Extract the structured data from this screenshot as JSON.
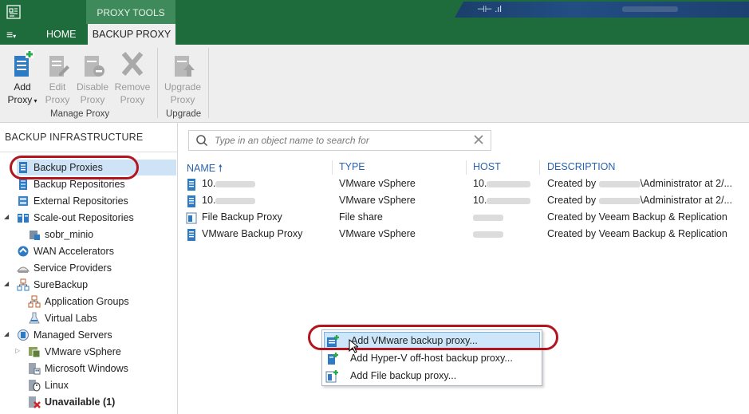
{
  "window": {
    "context_tab": "PROXY TOOLS"
  },
  "tabs": {
    "menu": "≡",
    "home": "HOME",
    "backup_proxy": "BACKUP PROXY"
  },
  "ribbon": {
    "buttons": [
      {
        "line1": "Add",
        "line2": "Proxy",
        "enabled": true,
        "icon": "add-proxy-icon"
      },
      {
        "line1": "Edit",
        "line2": "Proxy",
        "enabled": false,
        "icon": "edit-proxy-icon"
      },
      {
        "line1": "Disable",
        "line2": "Proxy",
        "enabled": false,
        "icon": "disable-proxy-icon"
      },
      {
        "line1": "Remove",
        "line2": "Proxy",
        "enabled": false,
        "icon": "remove-proxy-icon"
      },
      {
        "line1": "Upgrade",
        "line2": "Proxy",
        "enabled": false,
        "icon": "upgrade-proxy-icon"
      }
    ],
    "groups": {
      "manage": "Manage Proxy",
      "upgrade": "Upgrade"
    }
  },
  "nav": {
    "title": "BACKUP INFRASTRUCTURE",
    "items": [
      {
        "label": "Backup Proxies",
        "icon": "proxy-icon"
      },
      {
        "label": "Backup Repositories",
        "icon": "repository-icon"
      },
      {
        "label": "External Repositories",
        "icon": "external-repository-icon"
      },
      {
        "label": "Scale-out Repositories",
        "icon": "scaleout-repository-icon"
      },
      {
        "label": "sobr_minio",
        "icon": "sobr-icon"
      },
      {
        "label": "WAN Accelerators",
        "icon": "wan-accelerator-icon"
      },
      {
        "label": "Service Providers",
        "icon": "service-provider-icon"
      },
      {
        "label": "SureBackup",
        "icon": "surebackup-icon"
      },
      {
        "label": "Application Groups",
        "icon": "application-group-icon"
      },
      {
        "label": "Virtual Labs",
        "icon": "virtual-lab-icon"
      },
      {
        "label": "Managed Servers",
        "icon": "managed-servers-icon"
      },
      {
        "label": "VMware vSphere",
        "icon": "vsphere-icon"
      },
      {
        "label": "Microsoft Windows",
        "icon": "windows-icon"
      },
      {
        "label": "Linux",
        "icon": "linux-icon"
      },
      {
        "label": "Unavailable (1)",
        "icon": "unavailable-icon"
      }
    ]
  },
  "search": {
    "placeholder": "Type in an object name to search for"
  },
  "table": {
    "columns": {
      "name": "NAME",
      "type": "TYPE",
      "host": "HOST",
      "description": "DESCRIPTION"
    },
    "rows": [
      {
        "name": "10.",
        "type": "VMware vSphere",
        "host": "10.",
        "desc_pre": "Created by",
        "desc_post": "\\Administrator at 2/..."
      },
      {
        "name": "10.",
        "type": "VMware vSphere",
        "host": "10.",
        "desc_pre": "Created by",
        "desc_post": "\\Administrator at 2/..."
      },
      {
        "name": "File Backup Proxy",
        "type": "File share",
        "host": "",
        "desc_pre": "Created by Veeam Backup & Replication",
        "desc_post": ""
      },
      {
        "name": "VMware Backup Proxy",
        "type": "VMware vSphere",
        "host": "",
        "desc_pre": "Created by Veeam Backup & Replication",
        "desc_post": ""
      }
    ]
  },
  "context_menu": {
    "items": [
      {
        "label": "Add VMware backup proxy...",
        "icon": "vmware-proxy-icon"
      },
      {
        "label": "Add Hyper-V off-host backup proxy...",
        "icon": "hyperv-proxy-icon"
      },
      {
        "label": "Add File backup proxy...",
        "icon": "file-proxy-icon"
      }
    ]
  },
  "colors": {
    "titlebar": "#1e6b3b",
    "link_header": "#2a62b0",
    "selection": "#cfe3f7",
    "annotation": "#b3151f"
  }
}
